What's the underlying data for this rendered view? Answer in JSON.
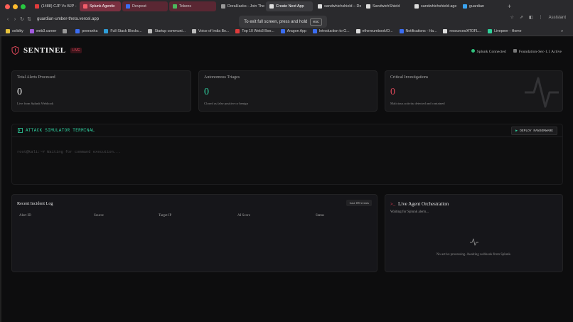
{
  "browser": {
    "tabs": [
      {
        "label": "(1488) CJP Vs BJP -",
        "color": "#e03b3b",
        "kind": "normal"
      },
      {
        "label": "Splunk Agentic",
        "color": "#f25d6a",
        "kind": "grpactive"
      },
      {
        "label": "Devpost",
        "color": "#3b6df2",
        "kind": "grp"
      },
      {
        "label": "Tokens",
        "color": "#4bb85c",
        "kind": "grp"
      },
      {
        "label": "DoraHacks - Join The",
        "color": "#999",
        "kind": "normal"
      },
      {
        "label": "Create Next App",
        "color": "#ddd",
        "kind": "active"
      },
      {
        "label": "sandwhichshield – De",
        "color": "#ddd",
        "kind": "normal"
      },
      {
        "label": "SandwichShield",
        "color": "#ddd",
        "kind": "normal"
      },
      {
        "label": "sandwhichshield-age",
        "color": "#ddd",
        "kind": "normal"
      },
      {
        "label": "guardian",
        "color": "#3aa3f0",
        "kind": "normal"
      }
    ],
    "new_tab": "+",
    "url": "guardian-umber-theta.vercel.app",
    "fullscreen_msg": "To exit full screen, press and hold",
    "esc_key": "esc",
    "assistant": "Assistant",
    "bookmarks": [
      {
        "label": "solidity",
        "color": "#e8c33b"
      },
      {
        "label": "web3.career",
        "color": "#a35be0"
      },
      {
        "label": "",
        "color": "#999"
      },
      {
        "label": "peeranha",
        "color": "#3b6df2"
      },
      {
        "label": "Full-Stack Blockc...",
        "color": "#2f9ed8"
      },
      {
        "label": "Startup communi...",
        "color": "#bbb"
      },
      {
        "label": "Voice of India Bo...",
        "color": "#bbb"
      },
      {
        "label": "Top 10 Web3 Boo...",
        "color": "#e03b3b"
      },
      {
        "label": "Aragon App",
        "color": "#3b6df2"
      },
      {
        "label": "Introduction to G...",
        "color": "#3b6df2"
      },
      {
        "label": "ethereumbook/O...",
        "color": "#ddd"
      },
      {
        "label": "Notifications - Ha...",
        "color": "#3b6df2"
      },
      {
        "label": "resources/ATOFL...",
        "color": "#ddd"
      },
      {
        "label": "Livepeer - Home",
        "color": "#2fd19a"
      }
    ],
    "more_bookmarks": "»"
  },
  "header": {
    "brand": "SENTINEL",
    "live_badge": "LIVE",
    "status_connected": "Splunk Connected",
    "status_model": "Foundation-Sec-1.1 Active"
  },
  "stats": [
    {
      "title": "Total Alerts Processed",
      "value": "0",
      "subtitle": "Live from Splunk Webhook",
      "color": "#f2f2f2"
    },
    {
      "title": "Autonomous Triages",
      "value": "0",
      "subtitle": "Closed as false positive or benign",
      "color": "#2fd1a0"
    },
    {
      "title": "Critical Investigations",
      "value": "0",
      "subtitle": "Malicious activity detected and contained",
      "color": "#e0485a"
    }
  ],
  "terminal": {
    "title": "ATTACK SIMULATOR TERMINAL",
    "deploy_label": "DEPLOY RANSOMWARE",
    "prompt_line": "root@kali:~# Waiting for command execution..."
  },
  "incident_log": {
    "title": "Recent Incident Log",
    "badge": "Last 100 events",
    "columns": [
      "Alert ID",
      "Source",
      "Target IP",
      "AI Score",
      "Status"
    ]
  },
  "orchestration": {
    "title": "Live Agent Orchestration",
    "status": "Waiting for Splunk alerts...",
    "empty": "No active processing. Awaiting webhook from Splunk."
  }
}
